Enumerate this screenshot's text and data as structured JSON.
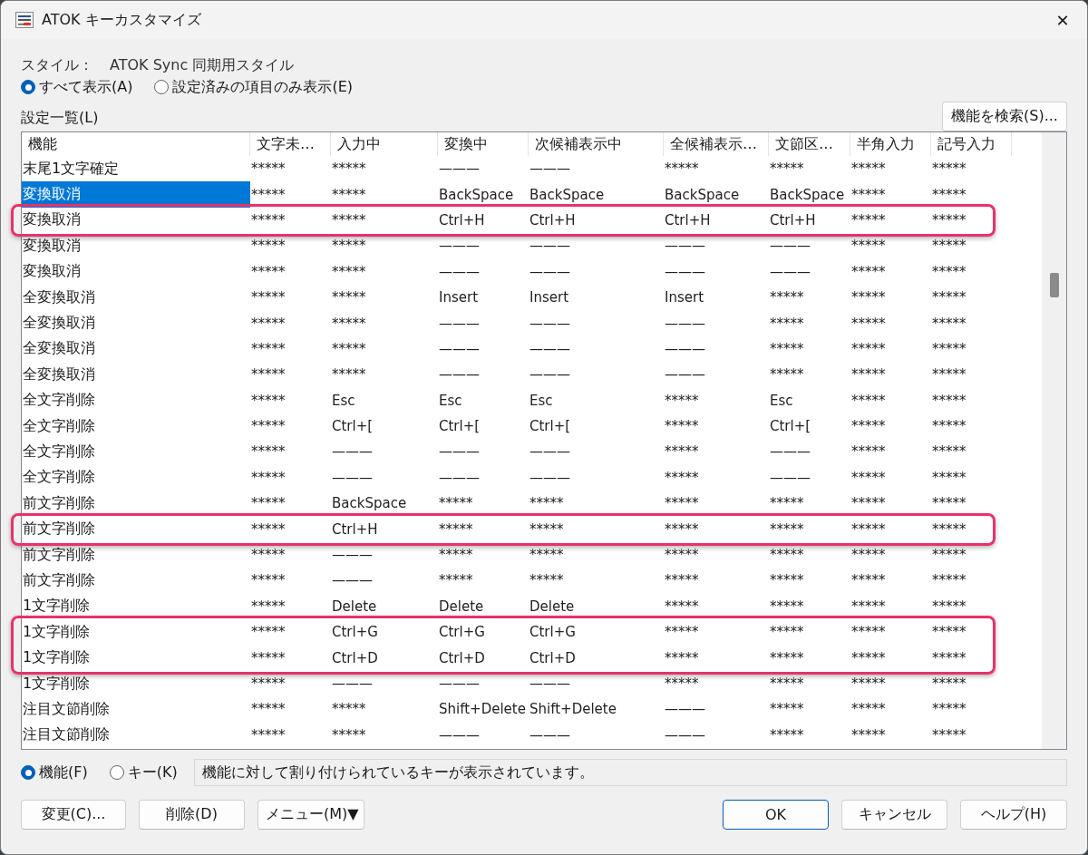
{
  "window": {
    "title": "ATOK キーカスタマイズ",
    "close": "✕"
  },
  "style": {
    "label": "スタイル：",
    "value": "ATOK Sync 同期用スタイル"
  },
  "display_options": [
    {
      "label": "すべて表示(A)",
      "selected": true
    },
    {
      "label": "設定済みの項目のみ表示(E)",
      "selected": false
    }
  ],
  "search_button": "機能を検索(S)...",
  "list_label": "設定一覧(L)",
  "table": {
    "columns": [
      "機能",
      "文字未…",
      "入力中",
      "変換中",
      "次候補表示中",
      "全候補表示…",
      "文節区…",
      "半角入力",
      "記号入力"
    ],
    "rows": [
      {
        "cells": [
          "末尾1文字確定",
          "*****",
          "*****",
          "———",
          "———",
          "*****",
          "*****",
          "*****",
          "*****"
        ],
        "selected": false,
        "highlighted": false
      },
      {
        "cells": [
          "変換取消",
          "*****",
          "*****",
          "BackSpace",
          "BackSpace",
          "BackSpace",
          "BackSpace",
          "*****",
          "*****"
        ],
        "selected": true,
        "highlighted": false
      },
      {
        "cells": [
          "変換取消",
          "*****",
          "*****",
          "Ctrl+H",
          "Ctrl+H",
          "Ctrl+H",
          "Ctrl+H",
          "*****",
          "*****"
        ],
        "selected": false,
        "highlighted": true
      },
      {
        "cells": [
          "変換取消",
          "*****",
          "*****",
          "———",
          "———",
          "———",
          "———",
          "*****",
          "*****"
        ],
        "selected": false,
        "highlighted": false
      },
      {
        "cells": [
          "変換取消",
          "*****",
          "*****",
          "———",
          "———",
          "———",
          "———",
          "*****",
          "*****"
        ],
        "selected": false,
        "highlighted": false
      },
      {
        "cells": [
          "全変換取消",
          "*****",
          "*****",
          "Insert",
          "Insert",
          "Insert",
          "*****",
          "*****",
          "*****"
        ],
        "selected": false,
        "highlighted": false
      },
      {
        "cells": [
          "全変換取消",
          "*****",
          "*****",
          "———",
          "———",
          "———",
          "*****",
          "*****",
          "*****"
        ],
        "selected": false,
        "highlighted": false
      },
      {
        "cells": [
          "全変換取消",
          "*****",
          "*****",
          "———",
          "———",
          "———",
          "*****",
          "*****",
          "*****"
        ],
        "selected": false,
        "highlighted": false
      },
      {
        "cells": [
          "全変換取消",
          "*****",
          "*****",
          "———",
          "———",
          "———",
          "*****",
          "*****",
          "*****"
        ],
        "selected": false,
        "highlighted": false
      },
      {
        "cells": [
          "全文字削除",
          "*****",
          "Esc",
          "Esc",
          "Esc",
          "*****",
          "Esc",
          "*****",
          "*****"
        ],
        "selected": false,
        "highlighted": false
      },
      {
        "cells": [
          "全文字削除",
          "*****",
          "Ctrl+[",
          "Ctrl+[",
          "Ctrl+[",
          "*****",
          "Ctrl+[",
          "*****",
          "*****"
        ],
        "selected": false,
        "highlighted": false
      },
      {
        "cells": [
          "全文字削除",
          "*****",
          "———",
          "———",
          "———",
          "*****",
          "———",
          "*****",
          "*****"
        ],
        "selected": false,
        "highlighted": false
      },
      {
        "cells": [
          "全文字削除",
          "*****",
          "———",
          "———",
          "———",
          "*****",
          "———",
          "*****",
          "*****"
        ],
        "selected": false,
        "highlighted": false
      },
      {
        "cells": [
          "前文字削除",
          "*****",
          "BackSpace",
          "*****",
          "*****",
          "*****",
          "*****",
          "*****",
          "*****"
        ],
        "selected": false,
        "highlighted": false
      },
      {
        "cells": [
          "前文字削除",
          "*****",
          "Ctrl+H",
          "*****",
          "*****",
          "*****",
          "*****",
          "*****",
          "*****"
        ],
        "selected": false,
        "highlighted": true
      },
      {
        "cells": [
          "前文字削除",
          "*****",
          "———",
          "*****",
          "*****",
          "*****",
          "*****",
          "*****",
          "*****"
        ],
        "selected": false,
        "highlighted": false
      },
      {
        "cells": [
          "前文字削除",
          "*****",
          "———",
          "*****",
          "*****",
          "*****",
          "*****",
          "*****",
          "*****"
        ],
        "selected": false,
        "highlighted": false
      },
      {
        "cells": [
          "1文字削除",
          "*****",
          "Delete",
          "Delete",
          "Delete",
          "*****",
          "*****",
          "*****",
          "*****"
        ],
        "selected": false,
        "highlighted": false
      },
      {
        "cells": [
          "1文字削除",
          "*****",
          "Ctrl+G",
          "Ctrl+G",
          "Ctrl+G",
          "*****",
          "*****",
          "*****",
          "*****"
        ],
        "selected": false,
        "highlighted": true
      },
      {
        "cells": [
          "1文字削除",
          "*****",
          "Ctrl+D",
          "Ctrl+D",
          "Ctrl+D",
          "*****",
          "*****",
          "*****",
          "*****"
        ],
        "selected": false,
        "highlighted": true
      },
      {
        "cells": [
          "1文字削除",
          "*****",
          "———",
          "———",
          "———",
          "*****",
          "*****",
          "*****",
          "*****"
        ],
        "selected": false,
        "highlighted": false
      },
      {
        "cells": [
          "注目文節削除",
          "*****",
          "*****",
          "Shift+Delete",
          "Shift+Delete",
          "———",
          "*****",
          "*****",
          "*****"
        ],
        "selected": false,
        "highlighted": false
      },
      {
        "cells": [
          "注目文節削除",
          "*****",
          "*****",
          "———",
          "———",
          "———",
          "*****",
          "*****",
          "*****"
        ],
        "selected": false,
        "highlighted": false
      }
    ]
  },
  "view_options": [
    {
      "label": "機能(F)",
      "selected": true
    },
    {
      "label": "キー(K)",
      "selected": false
    }
  ],
  "status": "機能に対して割り付けられているキーが表示されています。",
  "left_buttons": [
    "変更(C)...",
    "削除(D)",
    "メニュー(M)▼"
  ],
  "right_buttons": [
    {
      "label": "OK",
      "default": true
    },
    {
      "label": "キャンセル",
      "default": false
    },
    {
      "label": "ヘルプ(H)",
      "default": false
    }
  ]
}
